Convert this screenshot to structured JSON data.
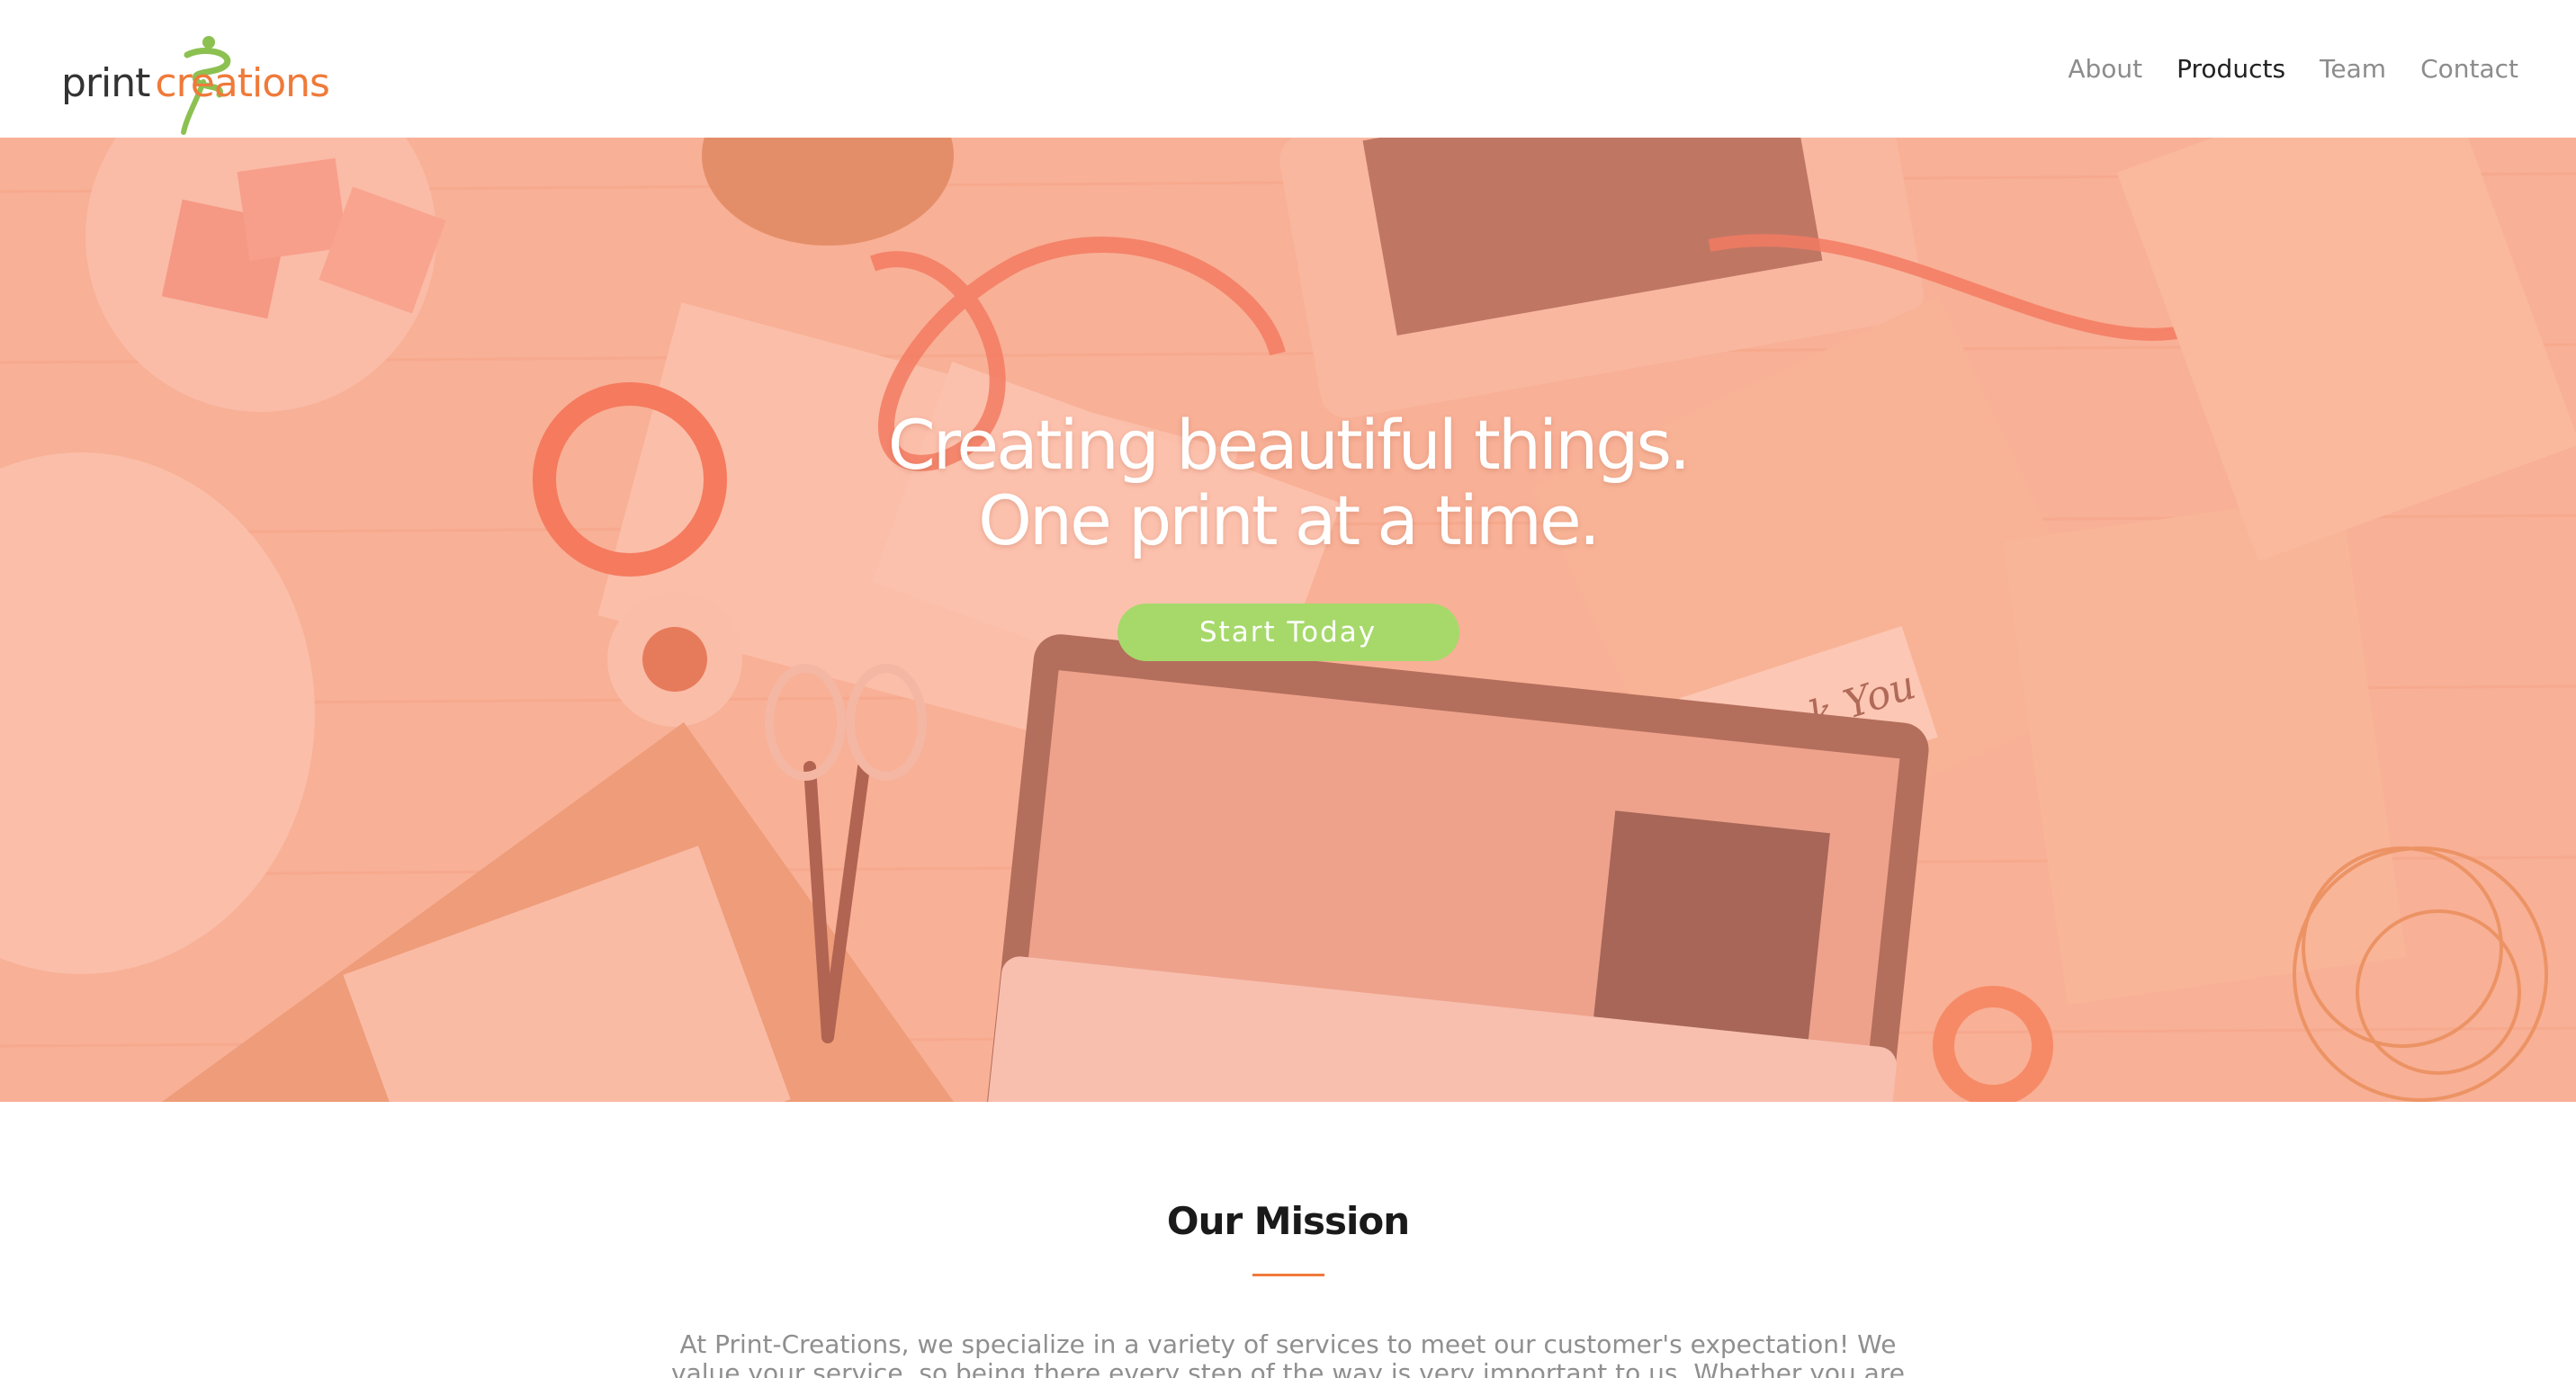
{
  "header": {
    "logo": {
      "part1": "print",
      "part2": "creations"
    },
    "nav": [
      {
        "label": "About",
        "active": false
      },
      {
        "label": "Products",
        "active": true
      },
      {
        "label": "Team",
        "active": false
      },
      {
        "label": "Contact",
        "active": false
      }
    ]
  },
  "hero": {
    "title_line1": "Creating beautiful things.",
    "title_line2": "One print at a time.",
    "cta_label": "Start Today",
    "overlay_color": "#f6b8a0",
    "cta_color": "#a6d96a"
  },
  "mission": {
    "title": "Our Mission",
    "text": "At Print-Creations, we specialize in a variety of services to meet our customer's expectation! We value your service, so being there every step of the way is very important to us. Whether you are looking to expand your",
    "accent_color": "#ef7a3a"
  },
  "icons": {
    "logo_mark": "ribbon-figure-icon"
  }
}
